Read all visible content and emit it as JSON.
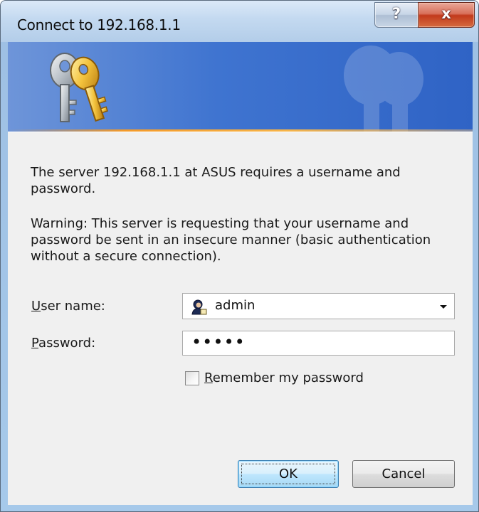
{
  "window": {
    "title": "Connect to 192.168.1.1",
    "help_glyph": "?",
    "close_glyph": "x",
    "icon": "keys-icon"
  },
  "message": {
    "line1": "The server 192.168.1.1 at ASUS requires a username and password.",
    "warning": "Warning: This server is requesting that your username and password be sent in an insecure manner (basic authentication without a secure connection)."
  },
  "form": {
    "username_label_accel": "U",
    "username_label_rest": "ser name:",
    "username_value": "admin",
    "password_label_accel": "P",
    "password_label_rest": "assword:",
    "password_value": "•••••",
    "remember_accel": "R",
    "remember_rest": "emember my password",
    "remember_checked": false
  },
  "buttons": {
    "ok": "OK",
    "cancel": "Cancel"
  },
  "colors": {
    "banner": "#3f74d0",
    "accent_line": "#f39a2a",
    "close_button": "#c23a1c"
  }
}
